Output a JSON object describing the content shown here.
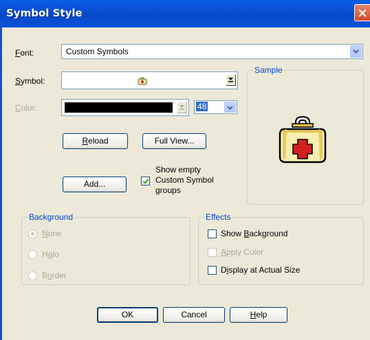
{
  "window": {
    "title": "Symbol Style"
  },
  "font": {
    "label": "Font:",
    "value": "Custom Symbols"
  },
  "symbol": {
    "label": "Symbol:"
  },
  "color": {
    "label": "Color:",
    "size_value": "48"
  },
  "buttons": {
    "reload": "Reload",
    "full_view": "Full View...",
    "add": "Add...",
    "ok": "OK",
    "cancel": "Cancel",
    "help": "Help"
  },
  "show_empty": {
    "line1": "Show empty",
    "line2": "Custom Symbol",
    "line3": "groups",
    "checked": true
  },
  "sample": {
    "title": "Sample",
    "icon": "first-aid-kit-icon"
  },
  "background": {
    "title": "Background",
    "options": [
      "None",
      "Halo",
      "Border"
    ],
    "selected": "None"
  },
  "effects": {
    "title": "Effects",
    "options": [
      {
        "label": "Show Background",
        "checked": false,
        "enabled": true
      },
      {
        "label": "Apply Color",
        "checked": false,
        "enabled": false
      },
      {
        "label": "Display at Actual Size",
        "checked": false,
        "enabled": true
      }
    ]
  },
  "colors": {
    "title_bar": "#0a52d9",
    "dialog_bg": "#ece9d8",
    "group_title": "#0046d5",
    "color_swatch": "#000000"
  }
}
